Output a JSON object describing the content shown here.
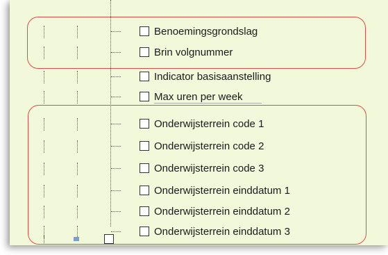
{
  "tree": {
    "items": [
      {
        "label": "Benoemingsgrondslag",
        "checked": false
      },
      {
        "label": "Brin volgnummer",
        "checked": false
      },
      {
        "label": "Indicator basisaanstelling",
        "checked": false
      },
      {
        "label": "Max uren per week",
        "checked": false
      },
      {
        "label": "Onderwijsterrein code 1",
        "checked": false
      },
      {
        "label": "Onderwijsterrein code 2",
        "checked": false
      },
      {
        "label": "Onderwijsterrein code 3",
        "checked": false
      },
      {
        "label": "Onderwijsterrein einddatum 1",
        "checked": false
      },
      {
        "label": "Onderwijsterrein einddatum 2",
        "checked": false
      },
      {
        "label": "Onderwijsterrein einddatum 3",
        "checked": false
      }
    ]
  },
  "colors": {
    "panel_background": "#f2f8da",
    "highlight_outline": "#e04a4a"
  }
}
